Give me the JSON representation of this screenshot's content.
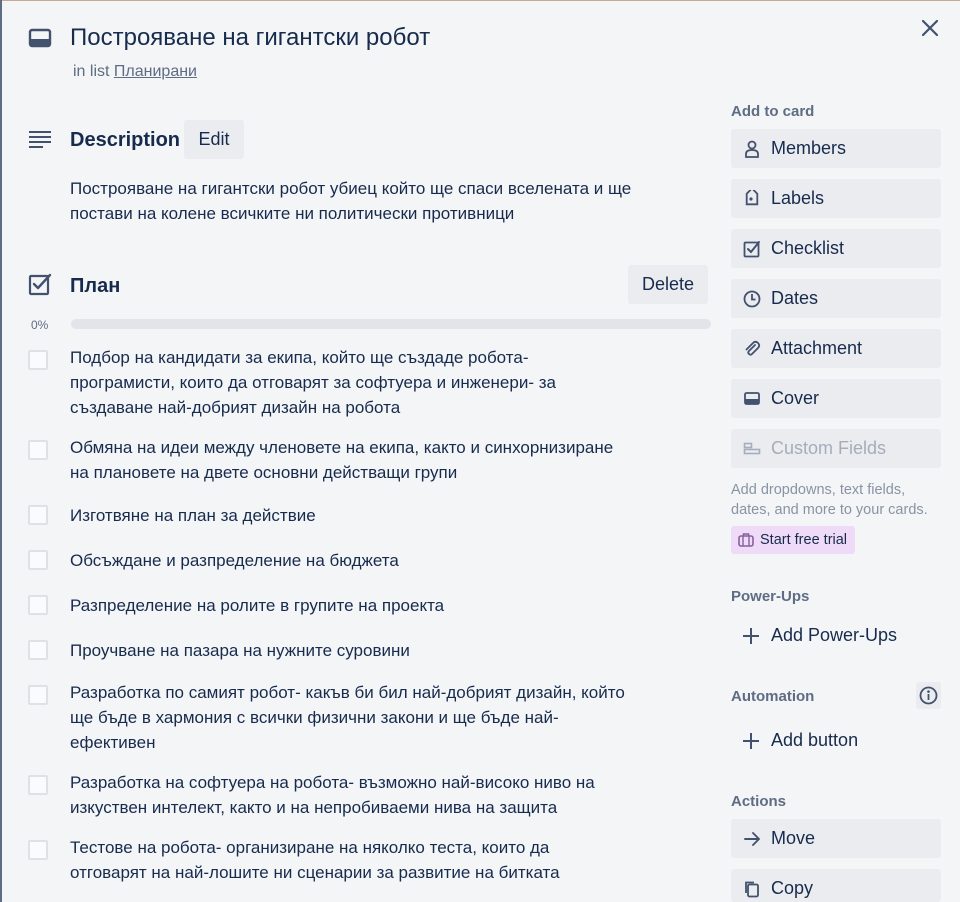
{
  "card": {
    "title": "Построяване на гигантски робот",
    "in_list_prefix": "in list",
    "list_name": "Планирани"
  },
  "description": {
    "title": "Description",
    "edit_label": "Edit",
    "text": "Построяване на гигантски робот убиец който ще спаси вселената и ще постави на колене всичките ни политически противници"
  },
  "checklist": {
    "title": "План",
    "delete_label": "Delete",
    "progress_text": "0%",
    "progress": 0,
    "items": [
      "Подбор на кандидати за екипа, който ще създаде робота- програмисти, които да отговарят за софтуера и инженери- за създаване най-добрият дизайн на робота",
      "Обмяна на идеи между членовете на екипа, както и синхорнизиране на плановете на двете основни действащи групи",
      "Изготвяне на план за действие",
      "Обсъждане и разпределение на бюджета",
      "Разпределение на ролите в групите на проекта",
      "Проучване на пазара на нужните суровини",
      "Разработка по самият робот- какъв би бил най-добрият дизайн, който ще бъде в хармония с всички физични закони и ще бъде най-ефективен",
      "Разработка на софтуера на робота- възможно най-високо ниво на изкуствен интелект, както и на непробиваеми нива на защита",
      "Тестове на робота- организиране на няколко теста, които да отговарят на най-лошите ни сценарии за развитие на битката"
    ]
  },
  "sidebar": {
    "add_to_card_label": "Add to card",
    "add_to_card": [
      "Members",
      "Labels",
      "Checklist",
      "Dates",
      "Attachment",
      "Cover",
      "Custom Fields"
    ],
    "custom_fields_hint": "Add dropdowns, text fields, dates, and more to your cards.",
    "trial_label": "Start free trial",
    "powerups_label": "Power-Ups",
    "add_powerups": "Add Power-Ups",
    "automation_label": "Automation",
    "add_button": "Add button",
    "actions_label": "Actions",
    "actions": [
      "Move",
      "Copy"
    ]
  },
  "colors": {
    "text": "#172b4d",
    "muted": "#5e6c84",
    "button_bg": "#ebecf0",
    "trial_bg": "#efdbf8",
    "progress_fill": "#5aac44"
  }
}
